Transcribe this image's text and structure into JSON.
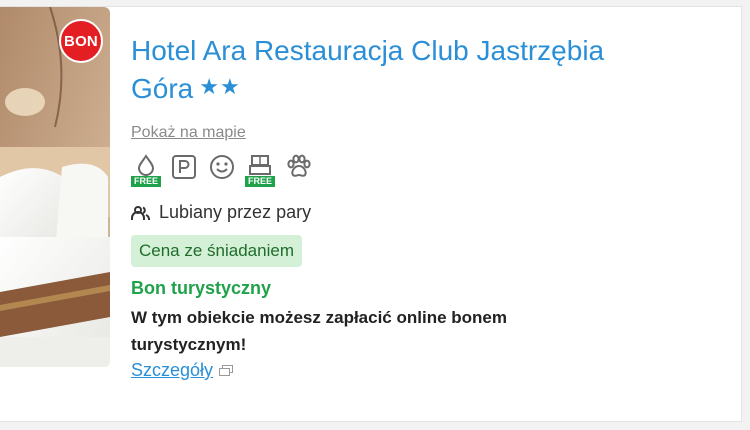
{
  "badge": {
    "label": "BON",
    "color": "#e41f24"
  },
  "hotel": {
    "name": "Hotel Ara Restauracja Club Jastrzębia Góra",
    "stars": "★★",
    "star_count": 2
  },
  "map_link": "Pokaż na mapie",
  "amenities": [
    {
      "icon": "water-drop-icon",
      "tag": "FREE"
    },
    {
      "icon": "parking-icon"
    },
    {
      "icon": "smiley-icon"
    },
    {
      "icon": "wifi-router-icon",
      "tag": "FREE"
    },
    {
      "icon": "paw-icon"
    }
  ],
  "liked_by": "Lubiany przez pary",
  "price_badge": "Cena ze śniadaniem",
  "voucher": {
    "title": "Bon turystyczny",
    "text": "W tym obiekcie możesz zapłacić online bonem turystycznym!",
    "details_link": "Szczegóły"
  },
  "colors": {
    "link_blue": "#2a8fd6",
    "green": "#1fa24a",
    "badge_bg": "#d4f0d6",
    "gray_icon": "#6a6a6a"
  }
}
